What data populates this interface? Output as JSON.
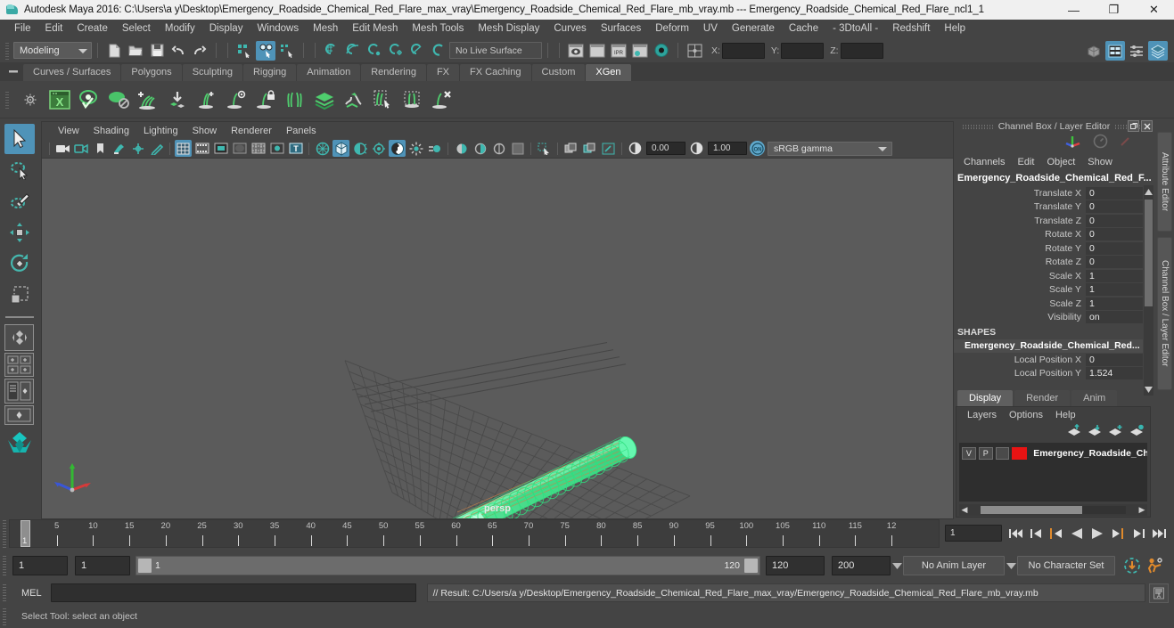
{
  "window": {
    "title": "Autodesk Maya 2016: C:\\Users\\a y\\Desktop\\Emergency_Roadside_Chemical_Red_Flare_max_vray\\Emergency_Roadside_Chemical_Red_Flare_mb_vray.mb  ---  Emergency_Roadside_Chemical_Red_Flare_ncl1_1",
    "minimize": "—",
    "maximize": "❐",
    "close": "✕"
  },
  "menubar": {
    "items": [
      "File",
      "Edit",
      "Create",
      "Select",
      "Modify",
      "Display",
      "Windows",
      "Mesh",
      "Edit Mesh",
      "Mesh Tools",
      "Mesh Display",
      "Curves",
      "Surfaces",
      "Deform",
      "UV",
      "Generate",
      "Cache",
      "- 3DtoAll -",
      "Redshift",
      "Help"
    ]
  },
  "statusline": {
    "mode": "Modeling",
    "live_surface": "No Live Surface",
    "axis_x_label": "X:",
    "axis_y_label": "Y:",
    "axis_z_label": "Z:",
    "axis_x_value": "",
    "axis_y_value": "",
    "axis_z_value": ""
  },
  "shelf": {
    "tabs": [
      "Curves / Surfaces",
      "Polygons",
      "Sculpting",
      "Rigging",
      "Animation",
      "Rendering",
      "FX",
      "FX Caching",
      "Custom",
      "XGen"
    ],
    "active_tab": "XGen",
    "icons": [
      "xgen-editor-icon",
      "xgen-preview-icon",
      "xgen-disable-preview-icon",
      "xgen-add-description-icon",
      "xgen-import-collection-icon",
      "xgen-create-groom-icon",
      "xgen-preview-groom-icon",
      "xgen-lock-groom-icon",
      "xgen-part-guides-icon",
      "xgen-layer-icon",
      "xgen-sculpt-icon",
      "xgen-select-guides-icon",
      "xgen-region-icon",
      "xgen-delete-guides-icon"
    ]
  },
  "toolbox": {
    "tools": [
      {
        "name": "select-tool",
        "selected": true
      },
      {
        "name": "lasso-select-tool",
        "selected": false
      },
      {
        "name": "paint-select-tool",
        "selected": false
      },
      {
        "name": "move-tool",
        "selected": false
      },
      {
        "name": "rotate-tool",
        "selected": false
      },
      {
        "name": "scale-tool",
        "selected": false
      }
    ],
    "layouts": [
      "single-perspective-layout",
      "four-view-layout",
      "outliner-persp-layout",
      "persp-graph-layout",
      "hypershade-layout"
    ]
  },
  "viewport": {
    "menus": [
      "View",
      "Shading",
      "Lighting",
      "Show",
      "Renderer",
      "Panels"
    ],
    "exposure_value": "0.00",
    "gamma_value": "1.00",
    "color_management": "sRGB gamma",
    "camera_label": "persp",
    "object_color": "#5bf0a0",
    "wire_color": "#2fe07f",
    "grid_color": "#4e4e4e",
    "background_color": "#5b5b5b"
  },
  "channel_box": {
    "panel_title": "Channel Box / Layer Editor",
    "menus": [
      "Channels",
      "Edit",
      "Object",
      "Show"
    ],
    "object_name": "Emergency_Roadside_Chemical_Red_F...",
    "transform_attrs": [
      {
        "label": "Translate X",
        "value": "0"
      },
      {
        "label": "Translate Y",
        "value": "0"
      },
      {
        "label": "Translate Z",
        "value": "0"
      },
      {
        "label": "Rotate X",
        "value": "0"
      },
      {
        "label": "Rotate Y",
        "value": "0"
      },
      {
        "label": "Rotate Z",
        "value": "0"
      },
      {
        "label": "Scale X",
        "value": "1"
      },
      {
        "label": "Scale Y",
        "value": "1"
      },
      {
        "label": "Scale Z",
        "value": "1"
      },
      {
        "label": "Visibility",
        "value": "on"
      }
    ],
    "shapes_header": "SHAPES",
    "shape_name": "Emergency_Roadside_Chemical_Red...",
    "shape_attrs": [
      {
        "label": "Local Position X",
        "value": "0"
      },
      {
        "label": "Local Position Y",
        "value": "1.524"
      }
    ]
  },
  "layer_editor": {
    "tabs": [
      "Display",
      "Render",
      "Anim"
    ],
    "active_tab": "Display",
    "menus": [
      "Layers",
      "Options",
      "Help"
    ],
    "buttons": [
      "move-layer-up-icon",
      "move-layer-down-icon",
      "create-new-layer-icon",
      "create-layer-from-selection-icon"
    ],
    "layers": [
      {
        "visibility": "V",
        "playback": "P",
        "shading": "",
        "color": "#e81313",
        "name": "Emergency_Roadside_Ch"
      }
    ]
  },
  "side_tabs": [
    {
      "label": "Attribute Editor"
    },
    {
      "label": "Channel Box / Layer Editor"
    }
  ],
  "timeline": {
    "tick_labels": [
      "5",
      "10",
      "15",
      "20",
      "25",
      "30",
      "35",
      "40",
      "45",
      "50",
      "55",
      "60",
      "65",
      "70",
      "75",
      "80",
      "85",
      "90",
      "95",
      "100",
      "105",
      "110",
      "115",
      "12"
    ],
    "current_frame": "1",
    "current_frame_field": "1",
    "playback_buttons": [
      "go-to-start-icon",
      "step-back-keyframe-icon",
      "step-back-frame-icon",
      "play-backwards-icon",
      "play-forwards-icon",
      "step-forward-frame-icon",
      "step-forward-keyframe-icon",
      "go-to-end-icon"
    ]
  },
  "range": {
    "anim_start": "1",
    "playback_start": "1",
    "slider_start_label": "1",
    "slider_end_label": "120",
    "playback_end": "120",
    "anim_end": "200",
    "anim_layer": "No Anim Layer",
    "character_set": "No Character Set",
    "icons": [
      "auto-keyframe-icon",
      "animation-preferences-icon"
    ]
  },
  "command_line": {
    "language_label": "MEL",
    "input_value": "",
    "result_text": "// Result: C:/Users/a y/Desktop/Emergency_Roadside_Chemical_Red_Flare_max_vray/Emergency_Roadside_Chemical_Red_Flare_mb_vray.mb",
    "script_editor_icon": "script-editor-icon"
  },
  "help_line": {
    "text": "Select Tool: select an object"
  },
  "colors": {
    "accent_blue": "#4f93b8",
    "shelf_green": "#57b85c",
    "teal": "#2ea39c",
    "panel_bg": "#444444",
    "viewport_bg": "#5b5b5b",
    "layer_red": "#e81313",
    "orange_marker": "#e08a2c"
  }
}
